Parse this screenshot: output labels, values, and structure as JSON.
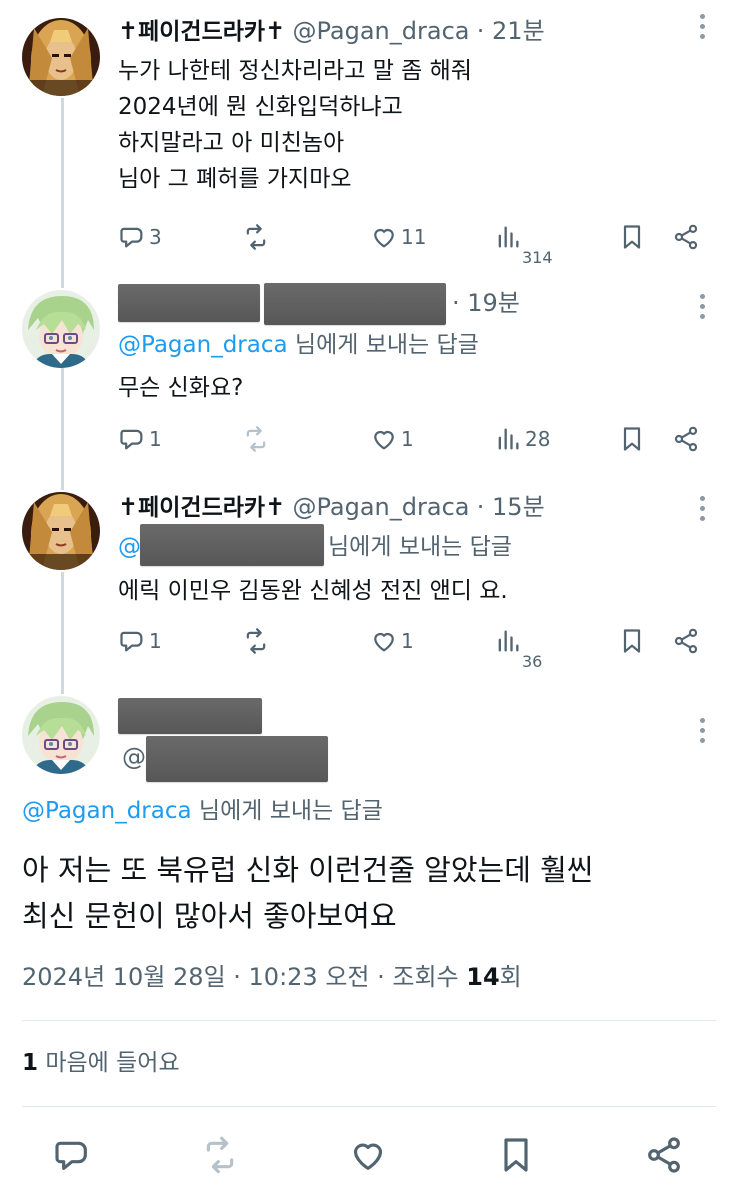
{
  "tweets": [
    {
      "name": "페이건드라카",
      "name_ornament": "✝",
      "handle": "@Pagan_draca",
      "time": "· 21분",
      "lines": [
        "누가 나한테 정신차리라고 말 좀 해줘",
        "2024년에 뭔 신화입덕하냐고",
        "하지말라고 아 미친놈아",
        "님아 그 폐허를 가지마오"
      ],
      "reply_count": "3",
      "like_count": "11",
      "view_count": "314"
    },
    {
      "time": "· 19분",
      "reply_to_handle": "@Pagan_draca",
      "reply_to_suffix": "님에게 보내는 답글",
      "lines": [
        "무슨 신화요?"
      ],
      "reply_count": "1",
      "like_count": "1",
      "view_count": "28"
    },
    {
      "name": "페이건드라카",
      "name_ornament": "✝",
      "handle": "@Pagan_draca",
      "time": "· 15분",
      "reply_to_handle": "@",
      "reply_to_suffix": "님에게 보내는 답글",
      "lines": [
        "에릭 이민우 김동완 신혜성 전진 앤디 요."
      ],
      "reply_count": "1",
      "like_count": "1",
      "view_count": "36"
    }
  ],
  "main_tweet": {
    "handle_prefix": "@",
    "reply_to_handle": "@Pagan_draca",
    "reply_to_suffix": "님에게 보내는 답글",
    "lines": [
      "아 저는 또 북유럽 신화 이런건줄 알았는데 훨씬",
      "최신 문헌이 많아서 좋아보여요"
    ],
    "timestamp": "2024년 10월 28일 · 10:23 오전 · 조회수",
    "views": "14",
    "views_suffix": "회",
    "likes_count": "1",
    "likes_label": "마음에 들어요"
  },
  "icons": [
    "reply-icon",
    "retweet-icon",
    "like-icon",
    "views-icon",
    "bookmark-icon",
    "share-icon",
    "more-icon"
  ],
  "colors": {
    "link": "#1d9bf0",
    "meta": "#536471",
    "thread_line": "#cfd9de",
    "redaction": "#606060"
  }
}
